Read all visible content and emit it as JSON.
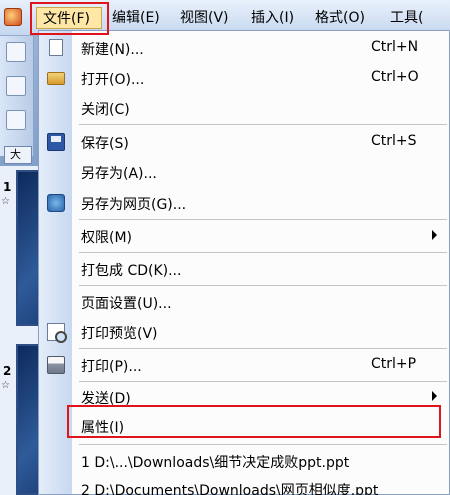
{
  "menubar": {
    "items": [
      {
        "label": "文件(F)"
      },
      {
        "label": "编辑(E)"
      },
      {
        "label": "视图(V)"
      },
      {
        "label": "插入(I)"
      },
      {
        "label": "格式(O)"
      },
      {
        "label": "工具("
      }
    ]
  },
  "left_panel": {
    "tab_label": "大",
    "slides": [
      {
        "number": "1",
        "marker": "☆"
      },
      {
        "number": "2",
        "marker": "☆"
      }
    ]
  },
  "file_menu": {
    "items": [
      {
        "label": "新建(N)...",
        "shortcut": "Ctrl+N",
        "icon": "new-document-icon"
      },
      {
        "label": "打开(O)...",
        "shortcut": "Ctrl+O",
        "icon": "open-folder-icon"
      },
      {
        "label": "关闭(C)",
        "shortcut": ""
      },
      {
        "label": "保存(S)",
        "shortcut": "Ctrl+S",
        "icon": "save-disk-icon"
      },
      {
        "label": "另存为(A)...",
        "shortcut": ""
      },
      {
        "label": "另存为网页(G)...",
        "shortcut": "",
        "icon": "web-page-icon"
      },
      {
        "label": "权限(M)",
        "shortcut": "",
        "submenu": true
      },
      {
        "label": "打包成 CD(K)...",
        "shortcut": ""
      },
      {
        "label": "页面设置(U)...",
        "shortcut": ""
      },
      {
        "label": "打印预览(V)",
        "shortcut": "",
        "icon": "print-preview-icon"
      },
      {
        "label": "打印(P)...",
        "shortcut": "Ctrl+P",
        "icon": "printer-icon"
      },
      {
        "label": "发送(D)",
        "shortcut": "",
        "submenu": true
      },
      {
        "label": "属性(I)",
        "shortcut": ""
      },
      {
        "label": "1 D:\\...\\Downloads\\细节决定成败ppt.ppt",
        "shortcut": ""
      },
      {
        "label": "2 D:\\Documents\\Downloads\\网页相似度.ppt",
        "shortcut": ""
      }
    ]
  },
  "colors": {
    "highlight_border": "#e0151c",
    "menu_bg": "#fcfcfc",
    "icon_column": "#c7d8f0"
  }
}
